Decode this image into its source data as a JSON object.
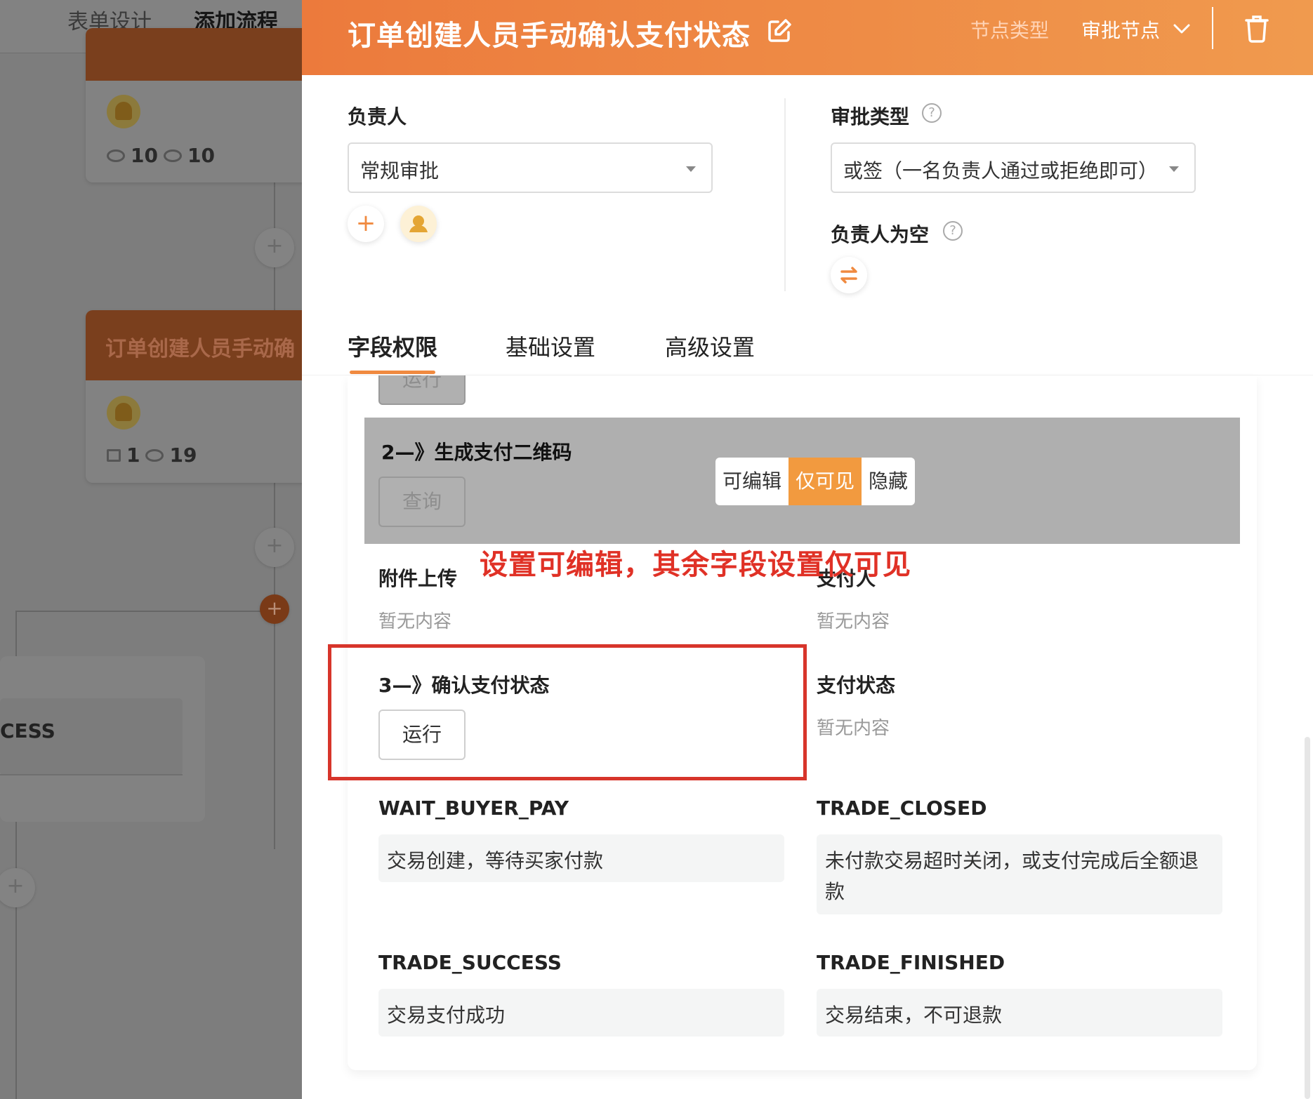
{
  "left": {
    "tab_form_design": "表单设计",
    "tab_add_flow": "添加流程",
    "card1": {
      "views_hidden": "10",
      "views": "10"
    },
    "card2": {
      "title": "订单创建人员手动确",
      "edits": "1",
      "views": "19"
    },
    "box_text": "CESS",
    "add_symbol": "+"
  },
  "header": {
    "title": "订单创建人员手动确认支付状态",
    "node_type_label": "节点类型",
    "node_type_value": "审批节点"
  },
  "form": {
    "owner_label": "负责人",
    "owner_select": "常规审批",
    "add_symbol": "+",
    "approval_type_label": "审批类型",
    "approval_type_select": "或签（一名负责人通过或拒绝即可）",
    "owner_empty_label": "负责人为空",
    "help_symbol": "?"
  },
  "tabs": [
    "字段权限",
    "基础设置",
    "高级设置"
  ],
  "content": {
    "run_label": "运行",
    "step2_label": "2—》生成支付二维码",
    "query_label": "查询",
    "permission_options": [
      "可编辑",
      "仅可见",
      "隐藏"
    ],
    "permission_selected": "仅可见",
    "attachment_label": "附件上传",
    "attachment_empty": "暂无内容",
    "payer_label": "支付人",
    "payer_empty": "暂无内容",
    "step3_label": "3—》确认支付状态",
    "step3_button": "运行",
    "pay_status_label": "支付状态",
    "pay_status_empty": "暂无内容",
    "statuses": [
      {
        "code": "WAIT_BUYER_PAY",
        "desc": "交易创建，等待买家付款"
      },
      {
        "code": "TRADE_CLOSED",
        "desc": "未付款交易超时关闭，或支付完成后全额退款"
      },
      {
        "code": "TRADE_SUCCESS",
        "desc": "交易支付成功"
      },
      {
        "code": "TRADE_FINISHED",
        "desc": "交易结束，不可退款"
      }
    ]
  },
  "annotation": "设置可编辑，其余字段设置仅可见",
  "colors": {
    "accent": "#f08a40",
    "annotation": "#e03126",
    "header_start": "#ec7a3c",
    "header_end": "#f09a4e"
  }
}
